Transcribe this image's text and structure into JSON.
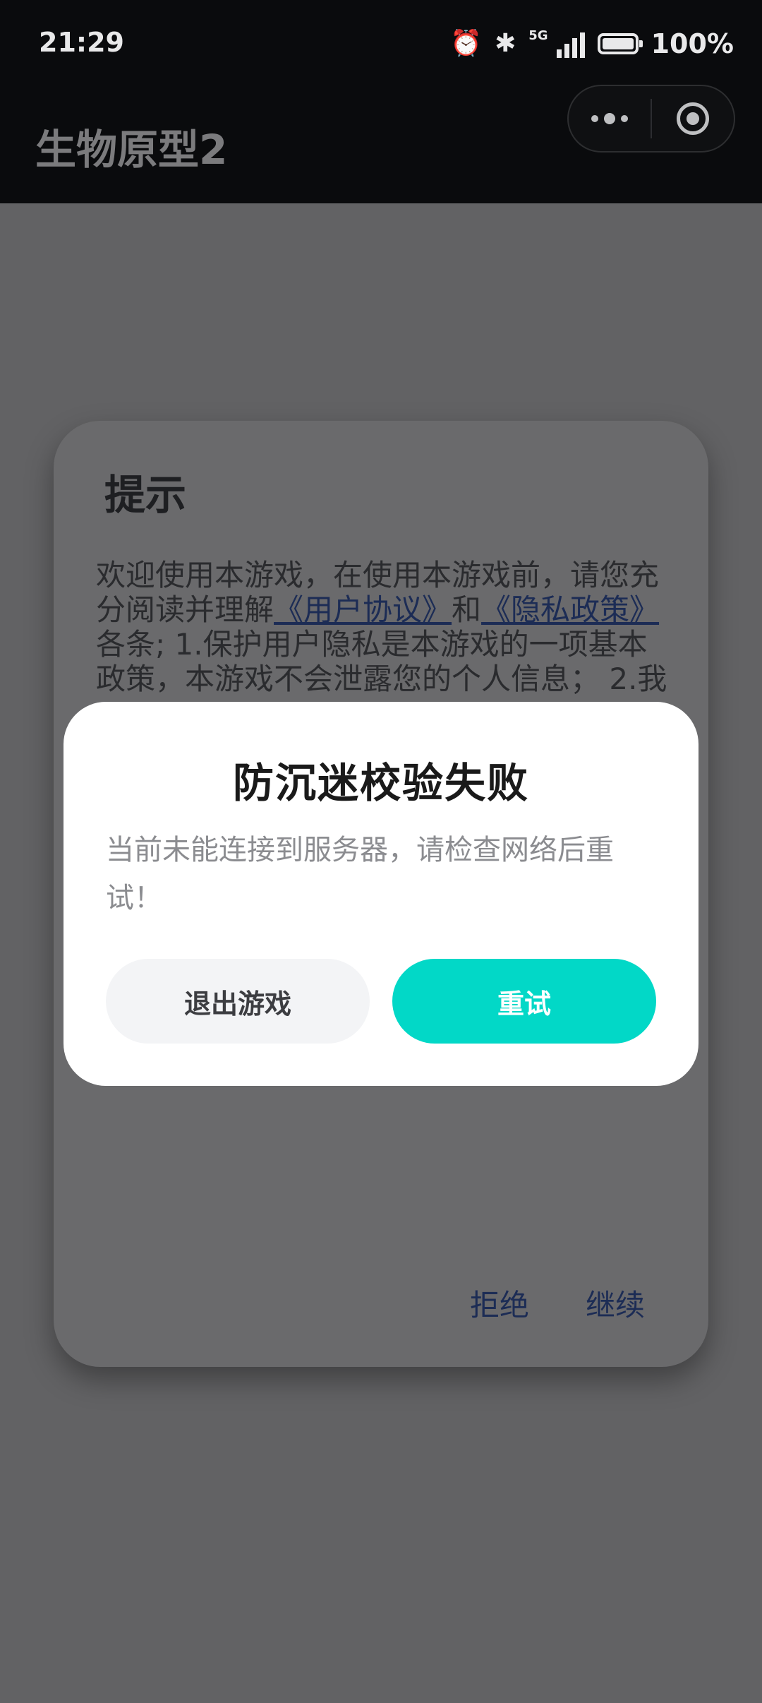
{
  "status_bar": {
    "time": "21:29",
    "network": "5G",
    "battery": "100%",
    "icons": [
      "alarm-icon",
      "bluetooth-icon",
      "signal-icon",
      "battery-icon"
    ]
  },
  "header": {
    "title": "生物原型2",
    "capsule_icons": [
      "more-icon",
      "close-target-icon"
    ]
  },
  "background_dialog": {
    "title": "提示",
    "body_prefix": "欢迎使用本游戏，在使用本游戏前，请您充分阅读并理解",
    "link_user_agreement": "《用户协议》",
    "and": "和",
    "link_privacy": "《隐私政策》",
    "body_suffix": "各条; 1.保护用户隐私是本游戏的一项基本政策，本游戏不会泄露您的个人信息； 2.我",
    "reject_label": "拒绝",
    "continue_label": "继续"
  },
  "modal": {
    "title": "防沉迷校验失败",
    "message": "当前未能连接到服务器，请检查网络后重试！",
    "exit_label": "退出游戏",
    "retry_label": "重试"
  },
  "colors": {
    "accent": "#02d8c7",
    "overlay": "#626264",
    "header_bg": "#0a0b0d",
    "link": "#1c2c55"
  }
}
